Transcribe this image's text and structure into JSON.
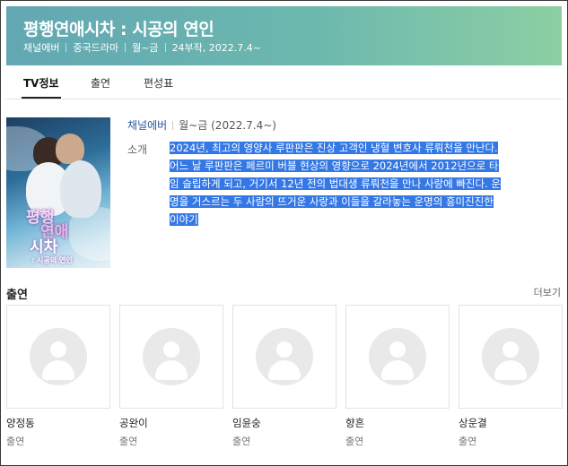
{
  "header": {
    "title": "평행연애시차 : 시공의 연인",
    "meta": [
      "채널에버",
      "중국드라마",
      "월~금",
      "24부작, 2022.7.4~"
    ]
  },
  "tabs": [
    {
      "label": "TV정보",
      "active": true
    },
    {
      "label": "출연",
      "active": false
    },
    {
      "label": "편성표",
      "active": false
    }
  ],
  "poster": {
    "title_lines": [
      "평행",
      "연애",
      "시차"
    ],
    "subtitle": ": 시공의 연인"
  },
  "info": {
    "channel": "채널에버",
    "schedule": "월~금 (2022.7.4~)",
    "desc_label": "소개",
    "desc_lines": [
      "2024년, 최고의 영양사 루판판은 진상 고객인 냉혈 변호사 류뤄천을 만난다.",
      "어느 날 루판판은 페르미 버블 현상의 영향으로 2024년에서 2012년으로 타",
      "임 슬립하게 되고, 거기서 12년 전의 법대생 류뤄천을 만나 사랑에 빠진다. 운",
      "명을 거스르는 두 사람의 뜨거운 사랑과 이들을 갈라놓는 운명의 흥미진진한",
      "이야기"
    ],
    "highlight_color": "#3478e6"
  },
  "cast": {
    "title": "출연",
    "more": "더보기",
    "members": [
      {
        "name": "양정동",
        "role": "출연"
      },
      {
        "name": "공완이",
        "role": "출연"
      },
      {
        "name": "임윤숭",
        "role": "출연"
      },
      {
        "name": "향흔",
        "role": "출연"
      },
      {
        "name": "상운결",
        "role": "출연"
      }
    ]
  },
  "colors": {
    "header_gradient_start": "#62a7b3",
    "header_gradient_end": "#8ccfa3",
    "channel_link": "#2b5a9e"
  }
}
